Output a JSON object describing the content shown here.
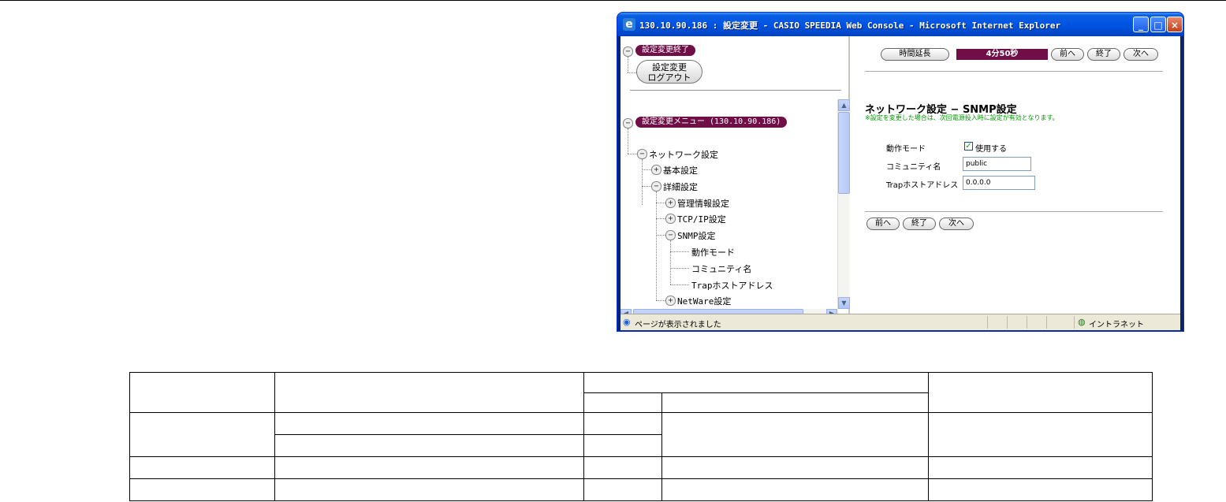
{
  "window": {
    "title": "130.10.90.186 : 設定変更 - CASIO SPEEDIA Web Console - Microsoft Internet Explorer",
    "minimize_glyph": "_",
    "maximize_glyph": "□",
    "close_glyph": "×"
  },
  "left_frame": {
    "end_pill": "設定変更終了",
    "logout_line1": "設定変更",
    "logout_line2": "ログアウト",
    "menu_pill": "設定変更メニュー (130.10.90.186)",
    "tree": [
      {
        "label": "ネットワーク設定",
        "toggle": "−"
      },
      {
        "label": "基本設定",
        "toggle": "+"
      },
      {
        "label": "詳細設定",
        "toggle": "−"
      },
      {
        "label": "管理情報設定",
        "toggle": "+"
      },
      {
        "label": "TCP/IP設定",
        "toggle": "+"
      },
      {
        "label": "SNMP設定",
        "toggle": "−"
      },
      {
        "label": "動作モード",
        "toggle": ""
      },
      {
        "label": "コミュニティ名",
        "toggle": ""
      },
      {
        "label": "Trapホストアドレス",
        "toggle": ""
      },
      {
        "label": "NetWare設定",
        "toggle": "+"
      }
    ]
  },
  "right_frame": {
    "extend_button": "時間延長",
    "timer": "4分50秒",
    "prev_button": "前へ",
    "end_button": "終了",
    "next_button": "次へ",
    "page_title": "ネットワーク設定  −  SNMP設定",
    "note": "※設定を変更した場合は、次回電源投入時に設定が有効となります。",
    "fields": {
      "mode_label": "動作モード",
      "mode_checkbox_label": "使用する",
      "mode_checked_glyph": "✓",
      "community_label": "コミュニティ名",
      "community_value": "public",
      "trap_label": "Trapホストアドレス",
      "trap_value": "0.0.0.0"
    }
  },
  "statusbar": {
    "message": "ページが表示されました",
    "zone": "イントラネット"
  }
}
